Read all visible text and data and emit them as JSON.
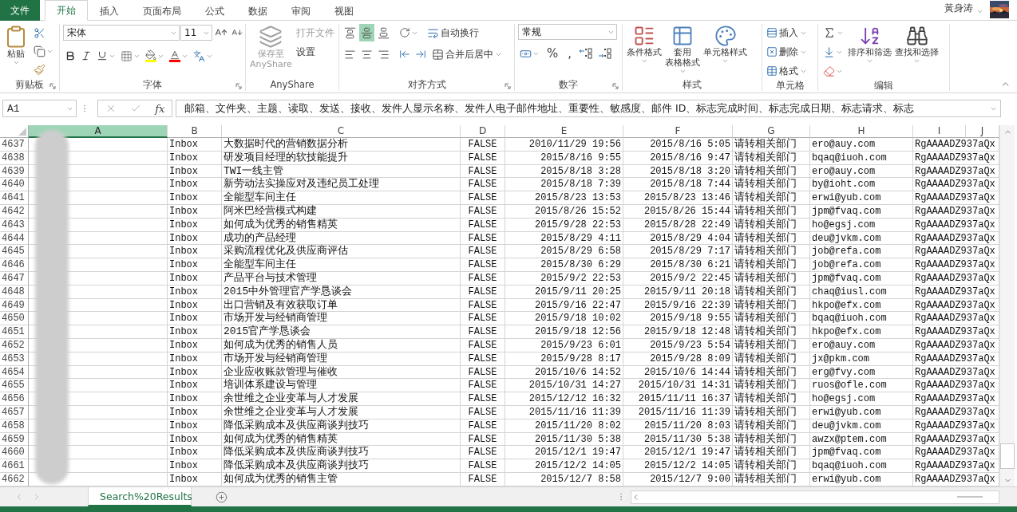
{
  "menu_tabs": [
    {
      "label": "文件",
      "kind": "file",
      "selected": false
    },
    {
      "label": "开始",
      "kind": "tab",
      "selected": true
    },
    {
      "label": "插入",
      "kind": "tab",
      "selected": false
    },
    {
      "label": "页面布局",
      "kind": "tab",
      "selected": false
    },
    {
      "label": "公式",
      "kind": "tab",
      "selected": false
    },
    {
      "label": "数据",
      "kind": "tab",
      "selected": false
    },
    {
      "label": "审阅",
      "kind": "tab",
      "selected": false
    },
    {
      "label": "视图",
      "kind": "tab",
      "selected": false
    }
  ],
  "account": {
    "user": "黃身涛"
  },
  "ribbon": {
    "clipboard": {
      "label": "剪贴板",
      "paste": "粘贴"
    },
    "font": {
      "label": "字体",
      "font_name": "宋体",
      "font_size": "11"
    },
    "anyshare": {
      "label": "AnyShare",
      "save": {
        "lines": [
          "保存至",
          "AnyShare"
        ],
        "disabled": true
      },
      "actions": [
        {
          "label": "打开文件",
          "disabled": true
        },
        {
          "label": "设置",
          "disabled": false
        }
      ]
    },
    "alignment": {
      "label": "对齐方式",
      "vertical": [
        {
          "kind": "top",
          "selected": false
        },
        {
          "kind": "middle",
          "selected": true
        },
        {
          "kind": "bottom",
          "selected": false
        }
      ],
      "wrap_text": "自动换行",
      "merge": "合并后居中"
    },
    "number": {
      "label": "数字",
      "format": "常规",
      "symbols": [
        "%",
        ","
      ]
    },
    "styles": {
      "label": "样式",
      "buttons": [
        {
          "kind": "conditional",
          "lines": [
            "条件格式"
          ]
        },
        {
          "kind": "table",
          "lines": [
            "套用",
            "表格格式"
          ]
        },
        {
          "kind": "cell",
          "lines": [
            "单元格样式"
          ]
        }
      ]
    },
    "cells": {
      "label": "单元格",
      "buttons": [
        {
          "kind": "insert",
          "label": "插入"
        },
        {
          "kind": "delete",
          "label": "删除"
        },
        {
          "kind": "format",
          "label": "格式"
        }
      ]
    },
    "editing": {
      "label": "编辑",
      "buttons": [
        {
          "kind": "sort",
          "label": "排序和筛选"
        },
        {
          "kind": "find",
          "label": "查找和选择"
        }
      ]
    }
  },
  "formula_bar": {
    "name_box": "A1",
    "function_label": "fx",
    "formula": "邮箱、文件夹、主题、读取、发送、接收、发件人显示名称、发件人电子邮件地址、重要性、敏感度、邮件 ID、标志完成时间、标志完成日期、标志请求、标志"
  },
  "sheet": {
    "columns": [
      {
        "label": "A",
        "selected": true
      },
      {
        "label": "B",
        "selected": false
      },
      {
        "label": "C",
        "selected": false
      },
      {
        "label": "D",
        "selected": false
      },
      {
        "label": "E",
        "selected": false
      },
      {
        "label": "F",
        "selected": false
      },
      {
        "label": "G",
        "selected": false
      },
      {
        "label": "H",
        "selected": false
      },
      {
        "label": "I",
        "selected": false
      },
      {
        "label": "J",
        "selected": false
      }
    ],
    "rows": [
      {
        "row": "4637",
        "cells": [
          "",
          "Inbox",
          "大数据时代的营销数据分析",
          "FALSE",
          "2010/11/29 19:56",
          "2015/8/16 5:05",
          "请转相关部门",
          "ero@auy.com",
          "RgAAAADZ937aQx"
        ]
      },
      {
        "row": "4638",
        "cells": [
          "",
          "Inbox",
          "研发项目经理的软技能提升",
          "FALSE",
          "2015/8/16 9:55",
          "2015/8/16 9:47",
          "请转相关部门",
          "bqaq@iuoh.com",
          "RgAAAADZ937aQx"
        ]
      },
      {
        "row": "4639",
        "cells": [
          "",
          "Inbox",
          "TWI一线主管",
          "FALSE",
          "2015/8/18 3:28",
          "2015/8/18 3:20",
          "请转相关部门",
          "ero@auy.com",
          "RgAAAADZ937aQx"
        ]
      },
      {
        "row": "4640",
        "cells": [
          "",
          "Inbox",
          "新劳动法实操应对及违纪员工处理",
          "FALSE",
          "2015/8/18 7:39",
          "2015/8/18 7:44",
          "请转相关部门",
          "by@ioht.com",
          "RgAAAADZ937aQx"
        ]
      },
      {
        "row": "4641",
        "cells": [
          "",
          "Inbox",
          "全能型车间主任",
          "FALSE",
          "2015/8/23 13:53",
          "2015/8/23 13:46",
          "请转相关部门",
          "erwi@yub.com",
          "RgAAAADZ937aQx"
        ]
      },
      {
        "row": "4642",
        "cells": [
          "",
          "Inbox",
          "阿米巴经营模式构建",
          "FALSE",
          "2015/8/26 15:52",
          "2015/8/26 15:44",
          "请转相关部门",
          "jpm@fvaq.com",
          "RgAAAADZ937aQx"
        ]
      },
      {
        "row": "4643",
        "cells": [
          "",
          "Inbox",
          "如何成为优秀的销售精英",
          "FALSE",
          "2015/9/28 22:53",
          "2015/8/28 22:49",
          "请转相关部门",
          "ho@egsj.com",
          "RgAAAADZ937aQx"
        ]
      },
      {
        "row": "4644",
        "cells": [
          "",
          "Inbox",
          "成功的产品经理",
          "FALSE",
          "2015/8/29 4:11",
          "2015/8/29 4:04",
          "请转相关部门",
          "deu@jvkm.com",
          "RgAAAADZ937aQx"
        ]
      },
      {
        "row": "4645",
        "cells": [
          "",
          "Inbox",
          "采购流程优化及供应商评估",
          "FALSE",
          "2015/8/29 6:58",
          "2015/8/29 7:17",
          "请转相关部门",
          "job@refa.com",
          "RgAAAADZ937aQx"
        ]
      },
      {
        "row": "4646",
        "cells": [
          "",
          "Inbox",
          "全能型车间主任",
          "FALSE",
          "2015/8/30 6:29",
          "2015/8/30 6:21",
          "请转相关部门",
          "job@refa.com",
          "RgAAAADZ937aQx"
        ]
      },
      {
        "row": "4647",
        "cells": [
          "",
          "Inbox",
          "产品平台与技术管理",
          "FALSE",
          "2015/9/2 22:53",
          "2015/9/2 22:45",
          "请转相关部门",
          "jpm@fvaq.com",
          "RgAAAADZ937aQx"
        ]
      },
      {
        "row": "4648",
        "cells": [
          "",
          "Inbox",
          "2015中外管理官产学恳谈会",
          "FALSE",
          "2015/9/11 20:25",
          "2015/9/11 20:18",
          "请转相关部门",
          "chaq@iusl.com",
          "RgAAAADZ937aQx"
        ]
      },
      {
        "row": "4649",
        "cells": [
          "",
          "Inbox",
          "出口营销及有效获取订单",
          "FALSE",
          "2015/9/16 22:47",
          "2015/9/16 22:39",
          "请转相关部门",
          "hkpo@efx.com",
          "RgAAAADZ937aQx"
        ]
      },
      {
        "row": "4650",
        "cells": [
          "",
          "Inbox",
          "市场开发与经销商管理",
          "FALSE",
          "2015/9/18 10:02",
          "2015/9/18 9:55",
          "请转相关部门",
          "bqaq@iuoh.com",
          "RgAAAADZ937aQx"
        ]
      },
      {
        "row": "4651",
        "cells": [
          "",
          "Inbox",
          "2015官产学恳谈会",
          "FALSE",
          "2015/9/18 12:56",
          "2015/9/18 12:48",
          "请转相关部门",
          "hkpo@efx.com",
          "RgAAAADZ937aQx"
        ]
      },
      {
        "row": "4652",
        "cells": [
          "",
          "Inbox",
          "如何成为优秀的销售人员",
          "FALSE",
          "2015/9/23 6:01",
          "2015/9/23 5:54",
          "请转相关部门",
          "ero@auy.com",
          "RgAAAADZ937aQx"
        ]
      },
      {
        "row": "4653",
        "cells": [
          "",
          "Inbox",
          "市场开发与经销商管理",
          "FALSE",
          "2015/9/28 8:17",
          "2015/9/28 8:09",
          "请转相关部门",
          "jx@pkm.com",
          "RgAAAADZ937aQx"
        ]
      },
      {
        "row": "4654",
        "cells": [
          "",
          "Inbox",
          "企业应收账款管理与催收",
          "FALSE",
          "2015/10/6 14:52",
          "2015/10/6 14:44",
          "请转相关部门",
          "erg@fvy.com",
          "RgAAAADZ937aQx"
        ]
      },
      {
        "row": "4655",
        "cells": [
          "",
          "Inbox",
          "培训体系建设与管理",
          "FALSE",
          "2015/10/31 14:27",
          "2015/10/31 14:31",
          "请转相关部门",
          "ruos@ofle.com",
          "RgAAAADZ937aQx"
        ]
      },
      {
        "row": "4656",
        "cells": [
          "",
          "Inbox",
          "余世维之企业变革与人才发展",
          "FALSE",
          "2015/12/12 16:32",
          "2015/11/11 16:37",
          "请转相关部门",
          "ho@egsj.com",
          "RgAAAADZ937aQx"
        ]
      },
      {
        "row": "4657",
        "cells": [
          "",
          "Inbox",
          "余世维之企业变革与人才发展",
          "FALSE",
          "2015/11/16 11:39",
          "2015/11/16 11:39",
          "请转相关部门",
          "erwi@yub.com",
          "RgAAAADZ937aQx"
        ]
      },
      {
        "row": "4658",
        "cells": [
          "",
          "Inbox",
          "降低采购成本及供应商谈判技巧",
          "FALSE",
          "2015/11/20 8:02",
          "2015/11/20 8:03",
          "请转相关部门",
          "deu@jvkm.com",
          "RgAAAADZ937aQx"
        ]
      },
      {
        "row": "4659",
        "cells": [
          "",
          "Inbox",
          "如何成为优秀的销售精英",
          "FALSE",
          "2015/11/30 5:38",
          "2015/11/30 5:38",
          "请转相关部门",
          "awzx@ptem.com",
          "RgAAAADZ937aQx"
        ]
      },
      {
        "row": "4660",
        "cells": [
          "",
          "Inbox",
          "降低采购成本及供应商谈判技巧",
          "FALSE",
          "2015/12/1 19:47",
          "2015/12/1 19:47",
          "请转相关部门",
          "jpm@fvaq.com",
          "RgAAAADZ937aQx"
        ]
      },
      {
        "row": "4661",
        "cells": [
          "",
          "Inbox",
          "降低采购成本及供应商谈判技巧",
          "FALSE",
          "2015/12/2 14:05",
          "2015/12/2 14:05",
          "请转相关部门",
          "bqaq@iuoh.com",
          "RgAAAADZ937aQx"
        ]
      },
      {
        "row": "4662",
        "cells": [
          "",
          "Inbox",
          "如何成为优秀的销售主管",
          "FALSE",
          "2015/12/7 8:58",
          "2015/12/7 9:00",
          "请转相关部门",
          "erwi@yub.com",
          "RgAAAADZ937aQx"
        ]
      }
    ]
  },
  "sheet_tabs": [
    {
      "label": "Search%20Results",
      "selected": true
    }
  ]
}
